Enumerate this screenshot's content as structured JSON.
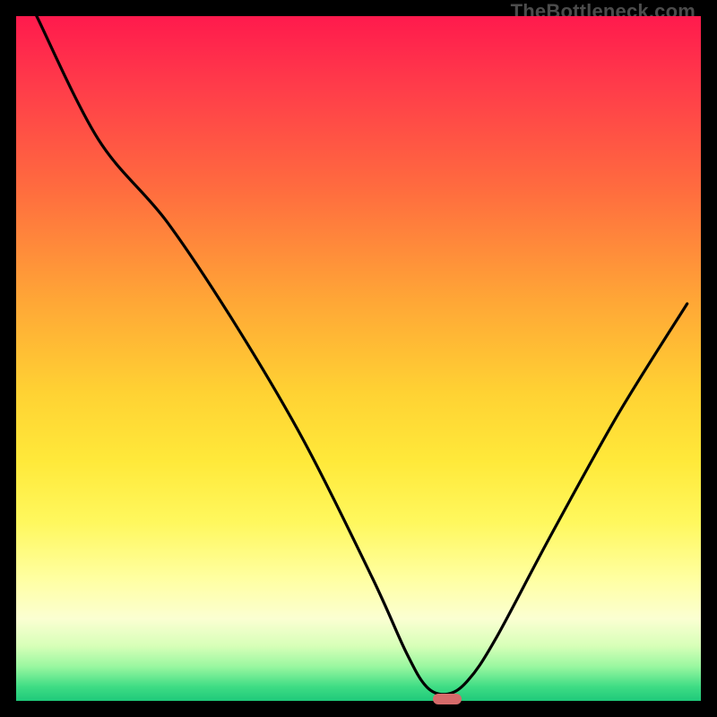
{
  "watermark": "TheBottleneck.com",
  "chart_data": {
    "type": "line",
    "title": "",
    "xlabel": "",
    "ylabel": "",
    "xlim": [
      0,
      100
    ],
    "ylim": [
      0,
      100
    ],
    "grid": false,
    "series": [
      {
        "name": "bottleneck-curve",
        "x": [
          3,
          12,
          22,
          32,
          42,
          52,
          57,
          60,
          63,
          66,
          70,
          78,
          88,
          98
        ],
        "values": [
          100,
          82,
          70,
          55,
          38,
          18,
          7,
          2,
          1,
          3,
          9,
          24,
          42,
          58
        ]
      }
    ],
    "marker": {
      "x": 63,
      "y": 0,
      "width_pct": 4.2,
      "height_pct": 1.6
    },
    "background_gradient": {
      "stops": [
        {
          "pct": 0,
          "color": "#ff1a4d"
        },
        {
          "pct": 25,
          "color": "#ff6b3f"
        },
        {
          "pct": 55,
          "color": "#ffd233"
        },
        {
          "pct": 82,
          "color": "#ffffa0"
        },
        {
          "pct": 100,
          "color": "#1fc97a"
        }
      ]
    },
    "axes_visible": false,
    "frame_color": "#000000"
  }
}
